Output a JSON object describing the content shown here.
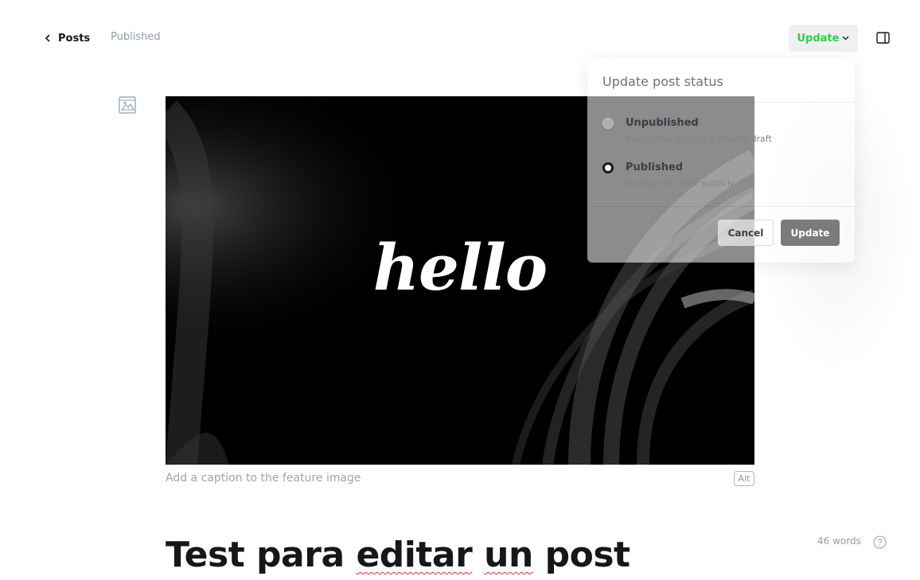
{
  "header": {
    "back_label": "Posts",
    "post_state": "Published",
    "update_label": "Update"
  },
  "feature_image": {
    "overlay_text": "hello",
    "caption_placeholder": "Add a caption to the feature image",
    "alt_label": "Alt"
  },
  "post": {
    "title_words": [
      "Test para",
      "editar",
      "un",
      "post"
    ],
    "word_count": "46 words"
  },
  "status_popover": {
    "title": "Update post status",
    "options": [
      {
        "label": "Unpublished",
        "description": "Revert this post to a private draft",
        "selected": false
      },
      {
        "label": "Published",
        "description": "Display this post publicly",
        "selected": true
      }
    ],
    "cancel_label": "Cancel",
    "confirm_label": "Update"
  },
  "colors": {
    "accent_green": "#30cf43",
    "text_dark": "#15171a",
    "muted": "#8e9cac"
  },
  "icons": {
    "back": "chevron-left-icon",
    "dropdown": "chevron-down-icon",
    "settings": "sidebar-toggle-icon",
    "image": "image-icon",
    "help": "question-circle-icon"
  }
}
